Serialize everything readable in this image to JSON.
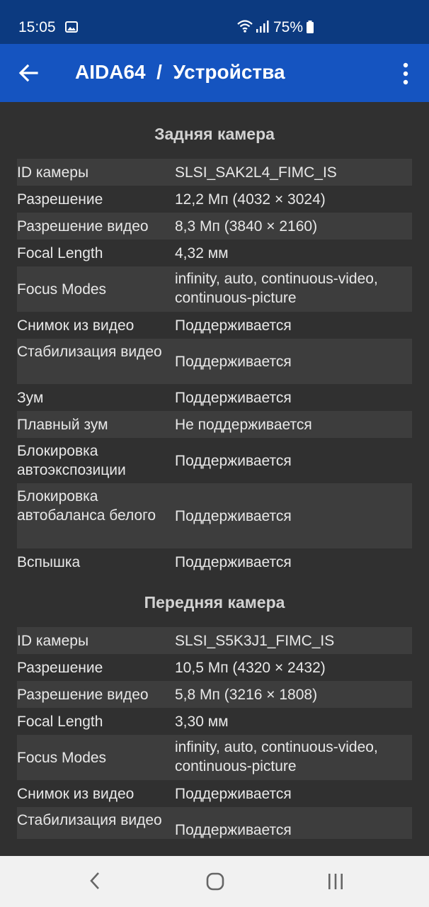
{
  "status_bar": {
    "time": "15:05",
    "battery": "75%"
  },
  "app_bar": {
    "title": "AIDA64  /  Устройства"
  },
  "rear_camera": {
    "title": "Задняя камера",
    "rows": [
      {
        "label": "ID камеры",
        "value": "SLSI_SAK2L4_FIMC_IS"
      },
      {
        "label": "Разрешение",
        "value": "12,2 Мп (4032 × 3024)"
      },
      {
        "label": "Разрешение видео",
        "value": "8,3 Мп (3840 × 2160)"
      },
      {
        "label": "Focal Length",
        "value": "4,32 мм"
      },
      {
        "label": "Focus Modes",
        "value": "infinity, auto, continuous-video, continuous-picture"
      },
      {
        "label": "Снимок из видео",
        "value": "Поддерживается"
      },
      {
        "label": "Стабилизация видео",
        "value": "Поддерживается"
      },
      {
        "label": "Зум",
        "value": "Поддерживается"
      },
      {
        "label": "Плавный зум",
        "value": "Не поддерживается"
      },
      {
        "label": "Блокировка автоэкспозиции",
        "value": "Поддерживается"
      },
      {
        "label": "Блокировка автобаланса белого",
        "value": "Поддерживается"
      },
      {
        "label": "Вспышка",
        "value": "Поддерживается"
      }
    ]
  },
  "front_camera": {
    "title": "Передняя камера",
    "rows": [
      {
        "label": "ID камеры",
        "value": "SLSI_S5K3J1_FIMC_IS"
      },
      {
        "label": "Разрешение",
        "value": "10,5 Мп (4320 × 2432)"
      },
      {
        "label": "Разрешение видео",
        "value": "5,8 Мп (3216 × 1808)"
      },
      {
        "label": "Focal Length",
        "value": "3,30 мм"
      },
      {
        "label": "Focus Modes",
        "value": "infinity, auto, continuous-video, continuous-picture"
      },
      {
        "label": "Снимок из видео",
        "value": "Поддерживается"
      },
      {
        "label": "Стабилизация видео",
        "value": "Поддерживается"
      }
    ]
  },
  "icons": {
    "back": "arrow-back-icon",
    "more": "more-vert-icon",
    "image": "image-icon",
    "wifi": "wifi-icon",
    "signal": "signal-icon",
    "battery": "battery-icon",
    "nav_back": "chevron-left-icon",
    "nav_home": "home-icon",
    "nav_recent": "recent-apps-icon"
  },
  "colors": {
    "status_bar": "#0c3a80",
    "app_bar": "#1554c0",
    "background": "#303030",
    "row_shade": "#3d3d3d",
    "nav_bar": "#f1f1f1"
  }
}
